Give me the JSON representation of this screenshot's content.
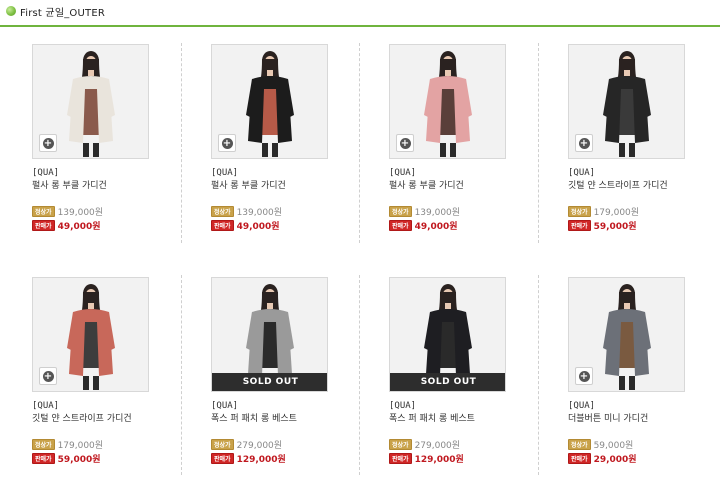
{
  "header": {
    "title": "First 균일_OUTER"
  },
  "products": [
    {
      "brand": "[QUA]",
      "name": "펄사 롱 부클 가디건",
      "regular_label": "정상가",
      "regular_price": "139,000원",
      "sale_label": "판매가",
      "sale_price": "49,000원",
      "sold_out": false,
      "garment_color": "#e9e4dc",
      "inner_color": "#8a5a4c"
    },
    {
      "brand": "[QUA]",
      "name": "펄사 롱 부클 가디건",
      "regular_label": "정상가",
      "regular_price": "139,000원",
      "sale_label": "판매가",
      "sale_price": "49,000원",
      "sold_out": false,
      "garment_color": "#1c1c1c",
      "inner_color": "#b65a48"
    },
    {
      "brand": "[QUA]",
      "name": "펄사 롱 부클 가디건",
      "regular_label": "정상가",
      "regular_price": "139,000원",
      "sale_label": "판매가",
      "sale_price": "49,000원",
      "sold_out": false,
      "garment_color": "#e3a3a3",
      "inner_color": "#5a3f3a"
    },
    {
      "brand": "[QUA]",
      "name": "깃털 얀 스트라이프 가디건",
      "regular_label": "정상가",
      "regular_price": "179,000원",
      "sale_label": "판매가",
      "sale_price": "59,000원",
      "sold_out": false,
      "garment_color": "#262626",
      "inner_color": "#3a3a3a"
    },
    {
      "brand": "[QUA]",
      "name": "깃털 얀 스트라이프 가디건",
      "regular_label": "정상가",
      "regular_price": "179,000원",
      "sale_label": "판매가",
      "sale_price": "59,000원",
      "sold_out": false,
      "garment_color": "#c8685a",
      "inner_color": "#3d3d3d"
    },
    {
      "brand": "[QUA]",
      "name": "폭스 퍼 패치 롱 베스트",
      "regular_label": "정상가",
      "regular_price": "279,000원",
      "sale_label": "판매가",
      "sale_price": "129,000원",
      "sold_out": true,
      "sold_out_label": "SOLD OUT",
      "garment_color": "#9a9a9a",
      "inner_color": "#2a2a2a"
    },
    {
      "brand": "[QUA]",
      "name": "폭스 퍼 패치 롱 베스트",
      "regular_label": "정상가",
      "regular_price": "279,000원",
      "sale_label": "판매가",
      "sale_price": "129,000원",
      "sold_out": true,
      "sold_out_label": "SOLD OUT",
      "garment_color": "#1e1e22",
      "inner_color": "#2a2a2a"
    },
    {
      "brand": "[QUA]",
      "name": "더블버튼 미니 가디건",
      "regular_label": "정상가",
      "regular_price": "59,000원",
      "sale_label": "판매가",
      "sale_price": "29,000원",
      "sold_out": false,
      "garment_color": "#6c7078",
      "inner_color": "#7a5a40"
    }
  ]
}
